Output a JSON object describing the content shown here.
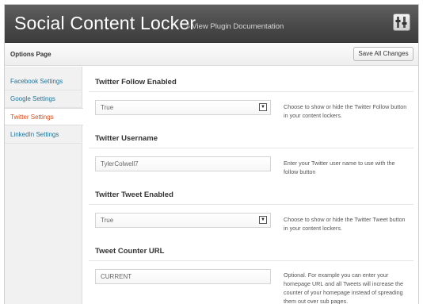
{
  "header": {
    "title": "Social Content Locker",
    "link_label": "View Plugin Documentation",
    "link_prefix": "»",
    "icon": "settings-tools-icon"
  },
  "toolbar": {
    "options_label": "Options Page",
    "save_label": "Save All Changes"
  },
  "sidebar": {
    "items": [
      {
        "label": "Facebook Settings"
      },
      {
        "label": "Google Settings"
      },
      {
        "label": "Twitter Settings",
        "active": true
      },
      {
        "label": "LinkedIn Settings"
      }
    ]
  },
  "settings": [
    {
      "title": "Twitter Follow Enabled",
      "type": "select",
      "value": "True",
      "description": "Choose to show or hide the Twitter Follow button in your content lockers."
    },
    {
      "title": "Twitter Username",
      "type": "text",
      "value": "TylerColwell7",
      "description": "Enter your Twitter user name to use with the follow button"
    },
    {
      "title": "Twitter Tweet Enabled",
      "type": "select",
      "value": "True",
      "description": "Choose to show or hide the Twitter Tweet button in your content lockers."
    },
    {
      "title": "Tweet Counter URL",
      "type": "text",
      "value": "CURRENT",
      "description": "Optional. For example you can enter your homepage URL and all Tweets will increase the counter of your homepage instead of spreading them out over sub pages."
    }
  ],
  "colors": {
    "header_bg": "#4a4a4a",
    "link": "#21759b",
    "active_link": "#d54e21"
  }
}
